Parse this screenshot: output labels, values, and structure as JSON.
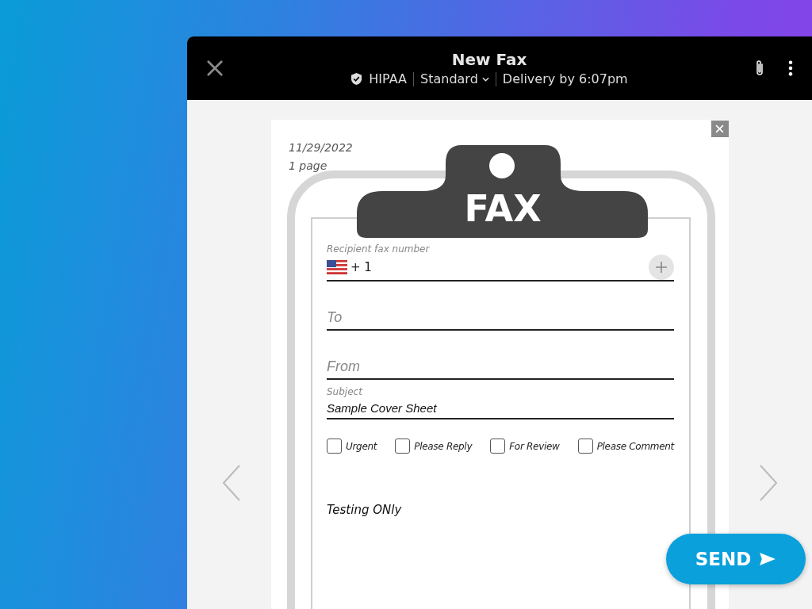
{
  "window": {
    "title": "New Fax",
    "security": "HIPAA",
    "quality": "Standard",
    "delivery": "Delivery by 6:07pm"
  },
  "cover": {
    "date": "11/29/2022",
    "pages": "1 page",
    "badge": "FAX"
  },
  "fields": [
    {
      "kind": "phone",
      "label": "Recipient fax number",
      "country_code": "+ 1"
    },
    {
      "kind": "text",
      "placeholder": "To"
    },
    {
      "kind": "text",
      "placeholder": "From"
    },
    {
      "kind": "labeled",
      "label": "Subject",
      "value": "Sample Cover Sheet"
    }
  ],
  "options": [
    {
      "label": "Urgent",
      "checked": false
    },
    {
      "label": "Please Reply",
      "checked": false
    },
    {
      "label": "For Review",
      "checked": false
    },
    {
      "label": "Please Comment",
      "checked": false
    }
  ],
  "message": "Testing ONly",
  "send_button": "SEND"
}
